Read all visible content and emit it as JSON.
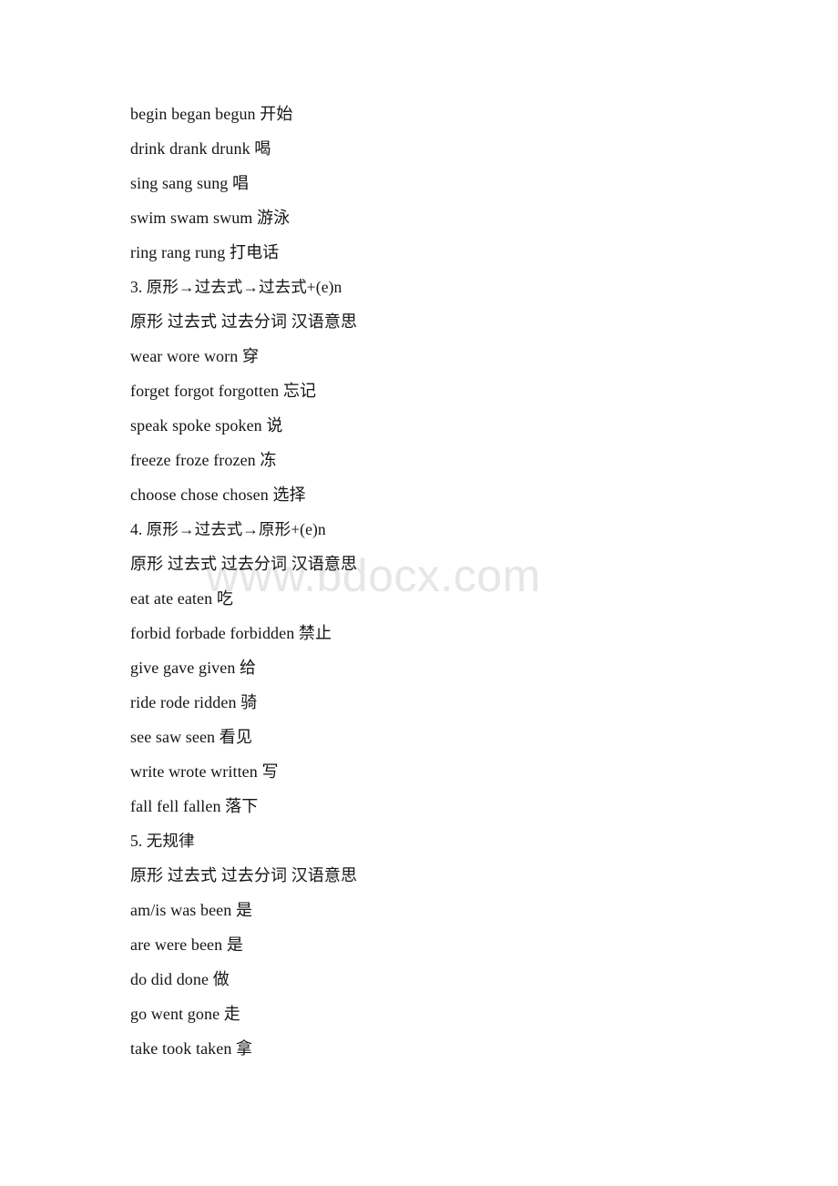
{
  "document": {
    "background_color": "#ffffff",
    "text_color": "#151515",
    "watermark": {
      "text": "www.bdocx.com",
      "color": "#e6e6e6"
    },
    "lines": [
      {
        "id": "l1",
        "type": "entry",
        "text": "begin began begun 开始"
      },
      {
        "id": "l2",
        "type": "entry",
        "text": "drink drank drunk 喝"
      },
      {
        "id": "l3",
        "type": "entry",
        "text": "sing sang sung 唱"
      },
      {
        "id": "l4",
        "type": "entry",
        "text": "swim swam swum 游泳"
      },
      {
        "id": "l5",
        "type": "entry",
        "text": "ring rang rung 打电话"
      },
      {
        "id": "l6",
        "type": "heading",
        "text": "3. 原形→过去式→过去式+(e)n"
      },
      {
        "id": "l7",
        "type": "columns",
        "text": "原形 过去式 过去分词 汉语意思"
      },
      {
        "id": "l8",
        "type": "entry",
        "text": "wear wore worn 穿"
      },
      {
        "id": "l9",
        "type": "entry",
        "text": "forget forgot forgotten 忘记"
      },
      {
        "id": "l10",
        "type": "entry",
        "text": "speak spoke spoken 说"
      },
      {
        "id": "l11",
        "type": "entry",
        "text": "freeze froze frozen 冻"
      },
      {
        "id": "l12",
        "type": "entry",
        "text": "choose chose chosen 选择"
      },
      {
        "id": "l13",
        "type": "heading",
        "text": "4. 原形→过去式→原形+(e)n"
      },
      {
        "id": "l14",
        "type": "columns",
        "text": "原形 过去式 过去分词 汉语意思"
      },
      {
        "id": "l15",
        "type": "entry",
        "text": "eat ate eaten 吃"
      },
      {
        "id": "l16",
        "type": "entry",
        "text": "forbid forbade forbidden 禁止"
      },
      {
        "id": "l17",
        "type": "entry",
        "text": "give gave given 给"
      },
      {
        "id": "l18",
        "type": "entry",
        "text": "ride rode ridden 骑"
      },
      {
        "id": "l19",
        "type": "entry",
        "text": "see saw seen 看见"
      },
      {
        "id": "l20",
        "type": "entry",
        "text": "write wrote written 写"
      },
      {
        "id": "l21",
        "type": "entry",
        "text": "fall fell fallen 落下"
      },
      {
        "id": "l22",
        "type": "heading",
        "text": "5. 无规律"
      },
      {
        "id": "l23",
        "type": "columns",
        "text": "原形 过去式 过去分词 汉语意思"
      },
      {
        "id": "l24",
        "type": "entry",
        "text": "am/is was been 是"
      },
      {
        "id": "l25",
        "type": "entry",
        "text": "are were been 是"
      },
      {
        "id": "l26",
        "type": "entry",
        "text": "do did done 做"
      },
      {
        "id": "l27",
        "type": "entry",
        "text": "go went gone 走"
      },
      {
        "id": "l28",
        "type": "entry",
        "text": "take took taken 拿"
      }
    ]
  }
}
